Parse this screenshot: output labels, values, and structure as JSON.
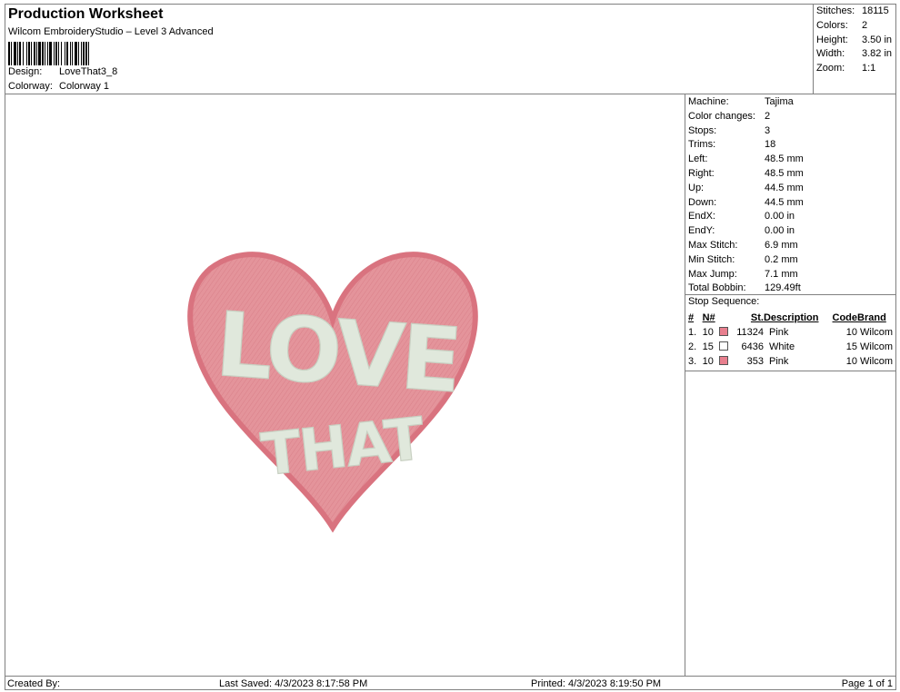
{
  "header": {
    "title": "Production Worksheet",
    "software": "Wilcom EmbroideryStudio – Level 3 Advanced",
    "design_label": "Design:",
    "design_value": "LoveThat3_8",
    "colorway_label": "Colorway:",
    "colorway_value": "Colorway 1"
  },
  "stats": [
    {
      "label": "Stitches:",
      "value": "18115"
    },
    {
      "label": "Colors:",
      "value": "2"
    },
    {
      "label": "Height:",
      "value": "3.50 in"
    },
    {
      "label": "Width:",
      "value": "3.82 in"
    },
    {
      "label": "Zoom:",
      "value": "1:1"
    }
  ],
  "machine_info": [
    {
      "label": "Machine:",
      "value": "Tajima"
    },
    {
      "label": "Color changes:",
      "value": "2"
    },
    {
      "label": "Stops:",
      "value": "3"
    },
    {
      "label": "Trims:",
      "value": "18"
    },
    {
      "label": "Left:",
      "value": "48.5 mm"
    },
    {
      "label": "Right:",
      "value": "48.5 mm"
    },
    {
      "label": "Up:",
      "value": "44.5 mm"
    },
    {
      "label": "Down:",
      "value": "44.5 mm"
    },
    {
      "label": "EndX:",
      "value": "0.00 in"
    },
    {
      "label": "EndY:",
      "value": "0.00 in"
    },
    {
      "label": "Max Stitch:",
      "value": "6.9 mm"
    },
    {
      "label": "Min Stitch:",
      "value": "0.2 mm"
    },
    {
      "label": "Max Jump:",
      "value": "7.1 mm"
    },
    {
      "label": "Total Bobbin:",
      "value": "129.49ft"
    }
  ],
  "stop_sequence": {
    "title": "Stop Sequence:",
    "columns": {
      "num": "#",
      "needle": "N#",
      "stitches": "St.",
      "description": "Description",
      "code": "Code",
      "brand": "Brand"
    },
    "rows": [
      {
        "num": "1.",
        "needle": "10",
        "color": "#e87f8e",
        "stitches": "11324",
        "description": "Pink",
        "code": "10",
        "brand": "Wilcom"
      },
      {
        "num": "2.",
        "needle": "15",
        "color": "#ffffff",
        "stitches": "6436",
        "description": "White",
        "code": "15",
        "brand": "Wilcom"
      },
      {
        "num": "3.",
        "needle": "10",
        "color": "#e87f8e",
        "stitches": "353",
        "description": "Pink",
        "code": "10",
        "brand": "Wilcom"
      }
    ]
  },
  "design": {
    "line1": "LOVE",
    "line2": "THAT",
    "fill_color": "#e48c95",
    "border_color": "#d9737f",
    "text_color": "#dfe6d8"
  },
  "footer": {
    "created_by": "Created By:",
    "last_saved": "Last Saved: 4/3/2023 8:17:58 PM",
    "printed": "Printed: 4/3/2023 8:19:50 PM",
    "page": "Page 1 of 1"
  }
}
